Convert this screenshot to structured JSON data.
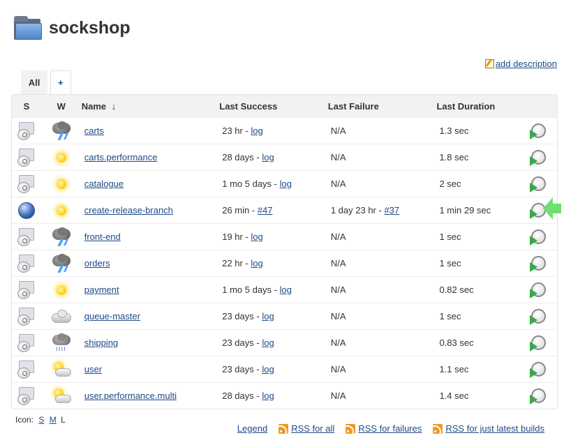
{
  "page": {
    "title": "sockshop",
    "add_description": "add description"
  },
  "tabs": [
    {
      "label": "All"
    },
    {
      "label": "+"
    }
  ],
  "table": {
    "headers": {
      "s": "S",
      "w": "W",
      "name": "Name",
      "sort_arrow": "↓",
      "last_success": "Last Success",
      "last_failure": "Last Failure",
      "last_duration": "Last Duration"
    },
    "rows": [
      {
        "status": "disabled",
        "weather": "storm",
        "name": "carts",
        "success_time": "23 hr - ",
        "success_link": "log",
        "failure_time": "N/A",
        "failure_link": "",
        "duration": "1.3 sec"
      },
      {
        "status": "disabled",
        "weather": "sun",
        "name": "carts.performance",
        "success_time": "28 days - ",
        "success_link": "log",
        "failure_time": "N/A",
        "failure_link": "",
        "duration": "1.8 sec"
      },
      {
        "status": "disabled",
        "weather": "sun",
        "name": "catalogue",
        "success_time": "1 mo 5 days - ",
        "success_link": "log",
        "failure_time": "N/A",
        "failure_link": "",
        "duration": "2 sec"
      },
      {
        "status": "blue",
        "weather": "sun",
        "name": "create-release-branch",
        "success_time": "26 min - ",
        "success_link": "#47",
        "failure_time": "1 day 23 hr - ",
        "failure_link": "#37",
        "duration": "1 min 29 sec"
      },
      {
        "status": "disabled",
        "weather": "storm",
        "name": "front-end",
        "success_time": "19 hr - ",
        "success_link": "log",
        "failure_time": "N/A",
        "failure_link": "",
        "duration": "1 sec"
      },
      {
        "status": "disabled",
        "weather": "storm",
        "name": "orders",
        "success_time": "22 hr - ",
        "success_link": "log",
        "failure_time": "N/A",
        "failure_link": "",
        "duration": "1 sec"
      },
      {
        "status": "disabled",
        "weather": "sun",
        "name": "payment",
        "success_time": "1 mo 5 days - ",
        "success_link": "log",
        "failure_time": "N/A",
        "failure_link": "",
        "duration": "0.82 sec"
      },
      {
        "status": "disabled",
        "weather": "cloud",
        "name": "queue-master",
        "success_time": "23 days - ",
        "success_link": "log",
        "failure_time": "N/A",
        "failure_link": "",
        "duration": "1 sec"
      },
      {
        "status": "disabled",
        "weather": "rain",
        "name": "shipping",
        "success_time": "23 days - ",
        "success_link": "log",
        "failure_time": "N/A",
        "failure_link": "",
        "duration": "0.83 sec"
      },
      {
        "status": "disabled",
        "weather": "partly",
        "name": "user",
        "success_time": "23 days - ",
        "success_link": "log",
        "failure_time": "N/A",
        "failure_link": "",
        "duration": "1.1 sec"
      },
      {
        "status": "disabled",
        "weather": "partly",
        "name": "user.performance.multi",
        "success_time": "28 days - ",
        "success_link": "log",
        "failure_time": "N/A",
        "failure_link": "",
        "duration": "1.4 sec"
      }
    ]
  },
  "icon_sizes": {
    "label": "Icon:",
    "s": "S",
    "m": "M",
    "l": "L"
  },
  "footer": {
    "legend": "Legend",
    "rss_all": "RSS for all",
    "rss_failures": "RSS for failures",
    "rss_latest": "RSS for just latest builds"
  },
  "colors": {
    "link": "#204a87",
    "header_bg": "#f2f2f2",
    "arrow": "#6ee06e"
  }
}
